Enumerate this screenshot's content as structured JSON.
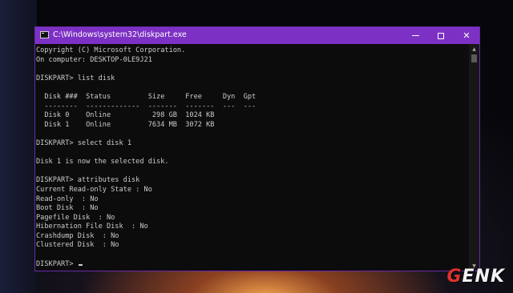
{
  "window": {
    "title": "C:\\Windows\\system32\\diskpart.exe",
    "controls": {
      "minimize": "minimize",
      "maximize": "maximize",
      "close": "close"
    },
    "accent": "#7d31c4"
  },
  "console": {
    "lines": [
      "Copyright (C) Microsoft Corporation.",
      "On computer: DESKTOP-0LE9J21",
      "",
      "DISKPART> list disk",
      "",
      "  Disk ###  Status         Size     Free     Dyn  Gpt",
      "  --------  -------------  -------  -------  ---  ---",
      "  Disk 0    Online          298 GB  1024 KB",
      "  Disk 1    Online         7634 MB  3072 KB",
      "",
      "DISKPART> select disk 1",
      "",
      "Disk 1 is now the selected disk.",
      "",
      "DISKPART> attributes disk",
      "Current Read-only State : No",
      "Read-only  : No",
      "Boot Disk  : No",
      "Pagefile Disk  : No",
      "Hibernation File Disk  : No",
      "Crashdump Disk  : No",
      "Clustered Disk  : No",
      ""
    ],
    "prompt": "DISKPART> "
  },
  "watermark": {
    "first": "G",
    "rest": "ENK"
  },
  "colors": {
    "console_bg": "#0c0c0c",
    "console_text": "#cccccc",
    "logo_red": "#e0312b"
  }
}
